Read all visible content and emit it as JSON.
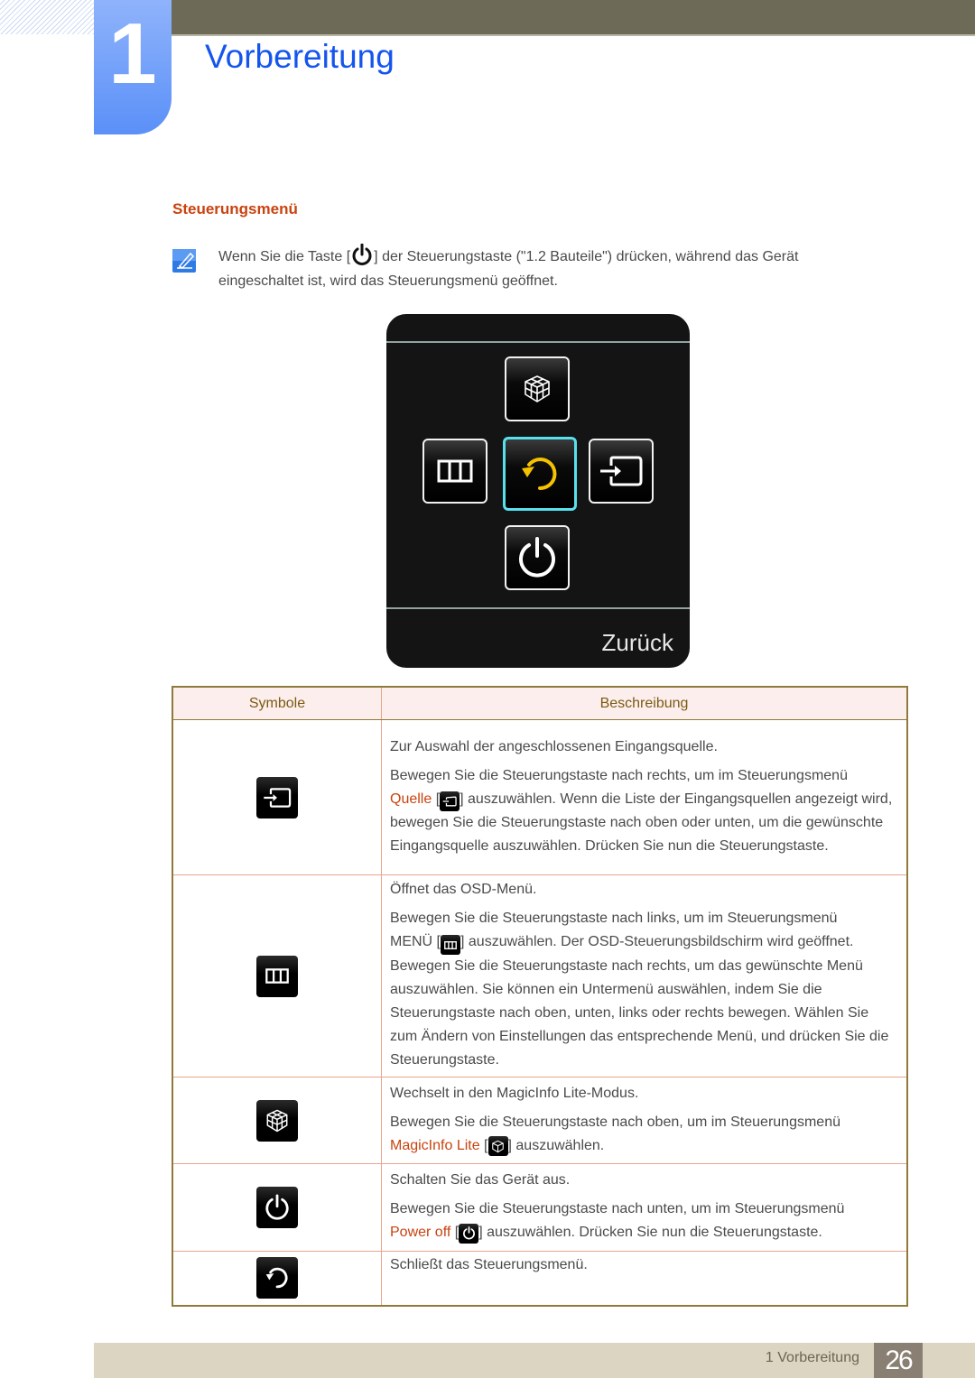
{
  "header": {
    "chapter_number": "1",
    "chapter_title": "Vorbereitung"
  },
  "section": {
    "title": "Steuerungsmenü"
  },
  "note": {
    "icon": "note-pencil-icon",
    "text_before": "Wenn Sie die Taste [",
    "text_after": "] der Steuerungstaste (\"1.2 Bauteile\") drücken, während das Gerät eingeschaltet ist, wird das Steuerungsmenü geöffnet."
  },
  "osd": {
    "buttons": [
      {
        "name": "magicinfo-lite",
        "icon": "cube-icon",
        "selected": false
      },
      {
        "name": "menu",
        "icon": "menu-bars-icon",
        "selected": false
      },
      {
        "name": "return",
        "icon": "return-arrow-icon",
        "selected": true
      },
      {
        "name": "source",
        "icon": "source-input-icon",
        "selected": false
      },
      {
        "name": "power-off",
        "icon": "power-icon",
        "selected": false
      }
    ],
    "back_label": "Zurück",
    "selected_color": "#59e0ef",
    "return_icon_color": "#f5c200"
  },
  "table": {
    "headers": [
      "Symbole",
      "Beschreibung"
    ],
    "rows": [
      {
        "icon": "source-input-icon",
        "paragraphs": [
          "Zur Auswahl der angeschlossenen Eingangsquelle.",
          "Bewegen Sie die Steuerungstaste nach rechts, um im Steuerungsmenü"
        ],
        "highlight": "Quelle",
        "after_icon": "] auszuwählen. Wenn die Liste der Eingangsquellen angezeigt wird, bewegen Sie die Steuerungstaste nach oben oder unten, um die gewünschte Eingangsquelle auszuwählen. Drücken Sie nun die Steuerungstaste."
      },
      {
        "icon": "menu-bars-icon",
        "paragraphs": [
          "Öffnet das OSD-Menü.",
          "Bewegen Sie die Steuerungstaste nach links, um im Steuerungsmenü"
        ],
        "highlight": "MENÜ",
        "after_icon": "] auszuwählen. Der OSD-Steuerungsbildschirm wird geöffnet. Bewegen Sie die Steuerungstaste nach rechts, um das gewünschte Menü auszuwählen. Sie können ein Untermenü auswählen, indem Sie die Steuerungstaste nach oben, unten, links oder rechts bewegen. Wählen Sie zum Ändern von Einstellungen das entsprechende Menü, und drücken Sie die Steuerungstaste."
      },
      {
        "icon": "cube-icon",
        "paragraphs": [
          "Wechselt in den MagicInfo Lite-Modus.",
          "Bewegen Sie die Steuerungstaste nach oben, um im Steuerungsmenü"
        ],
        "highlight": "MagicInfo Lite",
        "after_icon": "] auszuwählen."
      },
      {
        "icon": "power-icon",
        "paragraphs": [
          "Schalten Sie das Gerät aus.",
          "Bewegen Sie die Steuerungstaste nach unten, um im Steuerungsmenü"
        ],
        "highlight": "Power off",
        "after_icon": "] auszuwählen. Drücken Sie nun die Steuerungstaste."
      },
      {
        "icon": "return-arrow-icon",
        "paragraphs": [
          "Schließt das Steuerungsmenü."
        ]
      }
    ]
  },
  "footer": {
    "chapter_label": "1 Vorbereitung",
    "page_number": "26"
  },
  "colors": {
    "chapter_blue": "#1555ee",
    "section_orange": "#c9430f",
    "header_band": "#6d6b57",
    "footer_band": "#dbd5c1",
    "page_box": "#8a7f73"
  }
}
